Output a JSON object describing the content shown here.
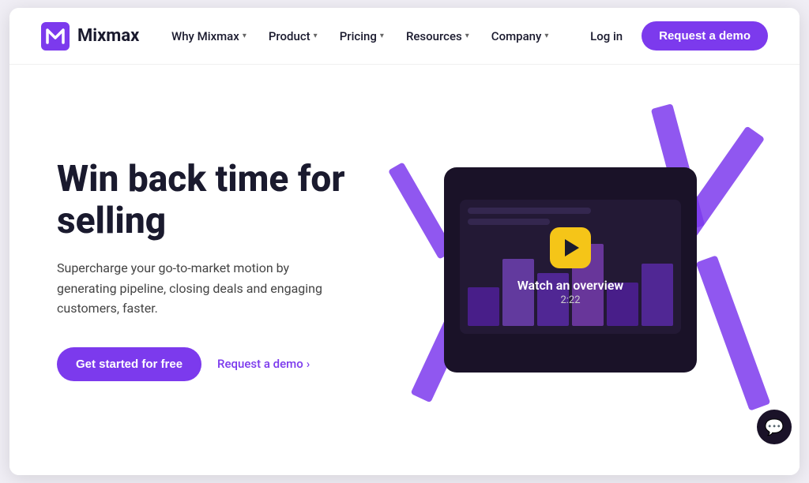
{
  "brand": {
    "name": "Mixmax",
    "logo_alt": "Mixmax logo"
  },
  "nav": {
    "items": [
      {
        "id": "why-mixmax",
        "label": "Why Mixmax",
        "has_dropdown": true
      },
      {
        "id": "product",
        "label": "Product",
        "has_dropdown": true
      },
      {
        "id": "pricing",
        "label": "Pricing",
        "has_dropdown": true
      },
      {
        "id": "resources",
        "label": "Resources",
        "has_dropdown": true
      },
      {
        "id": "company",
        "label": "Company",
        "has_dropdown": true
      }
    ],
    "login_label": "Log in",
    "demo_btn_label": "Request a demo"
  },
  "hero": {
    "title": "Win back time for selling",
    "subtitle": "Supercharge your go-to-market motion by generating pipeline, closing deals and engaging customers, faster.",
    "cta_primary": "Get started for free",
    "cta_secondary": "Request a demo",
    "cta_secondary_arrow": "›"
  },
  "video": {
    "label": "Watch an overview",
    "duration": "2:22"
  },
  "chat": {
    "icon": "💬"
  }
}
